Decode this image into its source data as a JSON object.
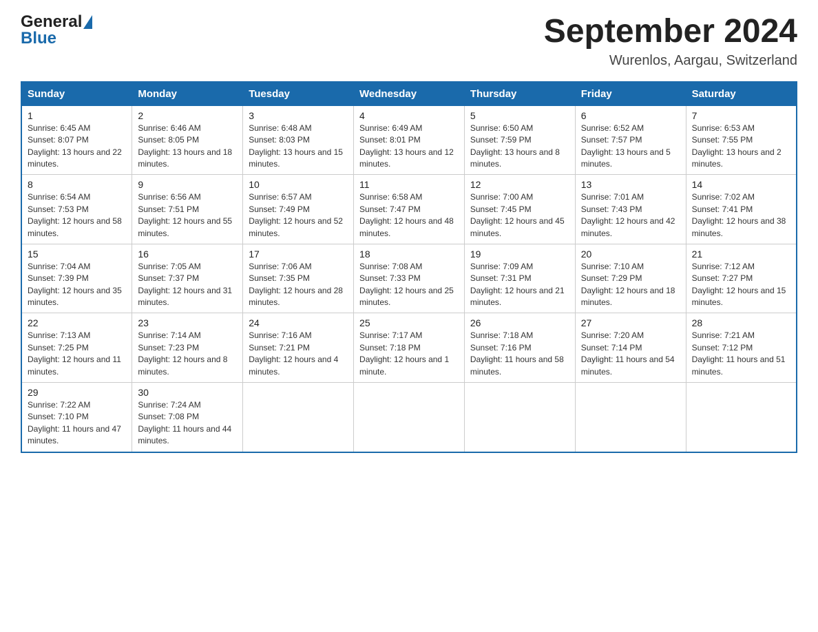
{
  "logo": {
    "general": "General",
    "blue": "Blue"
  },
  "header": {
    "month": "September 2024",
    "location": "Wurenlos, Aargau, Switzerland"
  },
  "weekdays": [
    "Sunday",
    "Monday",
    "Tuesday",
    "Wednesday",
    "Thursday",
    "Friday",
    "Saturday"
  ],
  "weeks": [
    [
      {
        "num": "1",
        "sunrise": "6:45 AM",
        "sunset": "8:07 PM",
        "daylight": "13 hours and 22 minutes."
      },
      {
        "num": "2",
        "sunrise": "6:46 AM",
        "sunset": "8:05 PM",
        "daylight": "13 hours and 18 minutes."
      },
      {
        "num": "3",
        "sunrise": "6:48 AM",
        "sunset": "8:03 PM",
        "daylight": "13 hours and 15 minutes."
      },
      {
        "num": "4",
        "sunrise": "6:49 AM",
        "sunset": "8:01 PM",
        "daylight": "13 hours and 12 minutes."
      },
      {
        "num": "5",
        "sunrise": "6:50 AM",
        "sunset": "7:59 PM",
        "daylight": "13 hours and 8 minutes."
      },
      {
        "num": "6",
        "sunrise": "6:52 AM",
        "sunset": "7:57 PM",
        "daylight": "13 hours and 5 minutes."
      },
      {
        "num": "7",
        "sunrise": "6:53 AM",
        "sunset": "7:55 PM",
        "daylight": "13 hours and 2 minutes."
      }
    ],
    [
      {
        "num": "8",
        "sunrise": "6:54 AM",
        "sunset": "7:53 PM",
        "daylight": "12 hours and 58 minutes."
      },
      {
        "num": "9",
        "sunrise": "6:56 AM",
        "sunset": "7:51 PM",
        "daylight": "12 hours and 55 minutes."
      },
      {
        "num": "10",
        "sunrise": "6:57 AM",
        "sunset": "7:49 PM",
        "daylight": "12 hours and 52 minutes."
      },
      {
        "num": "11",
        "sunrise": "6:58 AM",
        "sunset": "7:47 PM",
        "daylight": "12 hours and 48 minutes."
      },
      {
        "num": "12",
        "sunrise": "7:00 AM",
        "sunset": "7:45 PM",
        "daylight": "12 hours and 45 minutes."
      },
      {
        "num": "13",
        "sunrise": "7:01 AM",
        "sunset": "7:43 PM",
        "daylight": "12 hours and 42 minutes."
      },
      {
        "num": "14",
        "sunrise": "7:02 AM",
        "sunset": "7:41 PM",
        "daylight": "12 hours and 38 minutes."
      }
    ],
    [
      {
        "num": "15",
        "sunrise": "7:04 AM",
        "sunset": "7:39 PM",
        "daylight": "12 hours and 35 minutes."
      },
      {
        "num": "16",
        "sunrise": "7:05 AM",
        "sunset": "7:37 PM",
        "daylight": "12 hours and 31 minutes."
      },
      {
        "num": "17",
        "sunrise": "7:06 AM",
        "sunset": "7:35 PM",
        "daylight": "12 hours and 28 minutes."
      },
      {
        "num": "18",
        "sunrise": "7:08 AM",
        "sunset": "7:33 PM",
        "daylight": "12 hours and 25 minutes."
      },
      {
        "num": "19",
        "sunrise": "7:09 AM",
        "sunset": "7:31 PM",
        "daylight": "12 hours and 21 minutes."
      },
      {
        "num": "20",
        "sunrise": "7:10 AM",
        "sunset": "7:29 PM",
        "daylight": "12 hours and 18 minutes."
      },
      {
        "num": "21",
        "sunrise": "7:12 AM",
        "sunset": "7:27 PM",
        "daylight": "12 hours and 15 minutes."
      }
    ],
    [
      {
        "num": "22",
        "sunrise": "7:13 AM",
        "sunset": "7:25 PM",
        "daylight": "12 hours and 11 minutes."
      },
      {
        "num": "23",
        "sunrise": "7:14 AM",
        "sunset": "7:23 PM",
        "daylight": "12 hours and 8 minutes."
      },
      {
        "num": "24",
        "sunrise": "7:16 AM",
        "sunset": "7:21 PM",
        "daylight": "12 hours and 4 minutes."
      },
      {
        "num": "25",
        "sunrise": "7:17 AM",
        "sunset": "7:18 PM",
        "daylight": "12 hours and 1 minute."
      },
      {
        "num": "26",
        "sunrise": "7:18 AM",
        "sunset": "7:16 PM",
        "daylight": "11 hours and 58 minutes."
      },
      {
        "num": "27",
        "sunrise": "7:20 AM",
        "sunset": "7:14 PM",
        "daylight": "11 hours and 54 minutes."
      },
      {
        "num": "28",
        "sunrise": "7:21 AM",
        "sunset": "7:12 PM",
        "daylight": "11 hours and 51 minutes."
      }
    ],
    [
      {
        "num": "29",
        "sunrise": "7:22 AM",
        "sunset": "7:10 PM",
        "daylight": "11 hours and 47 minutes."
      },
      {
        "num": "30",
        "sunrise": "7:24 AM",
        "sunset": "7:08 PM",
        "daylight": "11 hours and 44 minutes."
      },
      null,
      null,
      null,
      null,
      null
    ]
  ]
}
